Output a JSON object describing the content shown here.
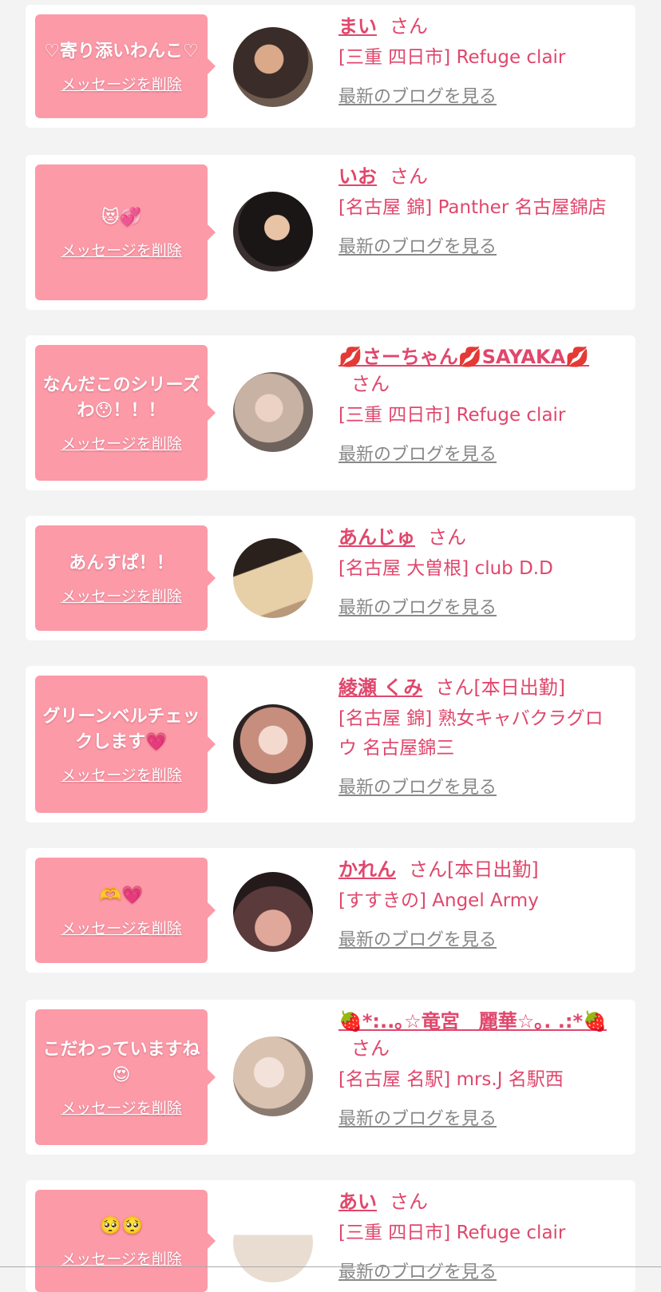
{
  "colors": {
    "accent": "#e0476c",
    "bubble": "#fc9aa8",
    "link_gray": "#888888"
  },
  "items": [
    {
      "message": "♡寄り添いわんこ♡",
      "delete_label": "メッセージを削除",
      "name": "まい",
      "honorific": "さん",
      "status": "",
      "shop": "[三重 四日市] Refuge clair",
      "blog_label": "最新のブログを見る"
    },
    {
      "message": "😻💞",
      "delete_label": "メッセージを削除",
      "name": "いお",
      "honorific": "さん",
      "status": "",
      "shop": "[名古屋 錦] Panther 名古屋錦店",
      "blog_label": "最新のブログを見る"
    },
    {
      "message": "なんだこのシリーズわ😯！！！",
      "delete_label": "メッセージを削除",
      "name": "💋さーちゃん💋SAYAKA💋",
      "honorific": "さん",
      "status": "",
      "shop": "[三重 四日市] Refuge clair",
      "blog_label": "最新のブログを見る"
    },
    {
      "message": "あんすぱ！！",
      "delete_label": "メッセージを削除",
      "name": "あんじゅ",
      "honorific": "さん",
      "status": "",
      "shop": "[名古屋 大曽根] club D.D",
      "blog_label": "最新のブログを見る"
    },
    {
      "message": "グリーンベルチェックします💗",
      "delete_label": "メッセージを削除",
      "name": "綾瀬 くみ",
      "honorific": "さん",
      "status": "[本日出勤]",
      "shop": "[名古屋 錦] 熟女キャバクラグロウ 名古屋錦三",
      "blog_label": "最新のブログを見る"
    },
    {
      "message": "🫶💗",
      "delete_label": "メッセージを削除",
      "name": "かれん",
      "honorific": "さん",
      "status": "[本日出勤]",
      "shop": "[すすきの] Angel Army",
      "blog_label": "最新のブログを見る"
    },
    {
      "message": "こだわっていますね😍",
      "delete_label": "メッセージを削除",
      "name": "🍓*:..｡☆竜宮　麗華☆｡. .:*🍓",
      "honorific": "さん",
      "status": "",
      "shop": "[名古屋 名駅] mrs.J 名駅西",
      "blog_label": "最新のブログを見る"
    },
    {
      "message": "🥺🥺",
      "delete_label": "メッセージを削除",
      "name": "あい",
      "honorific": "さん",
      "status": "",
      "shop": "[三重 四日市] Refuge clair",
      "blog_label": "最新のブログを見る"
    }
  ]
}
